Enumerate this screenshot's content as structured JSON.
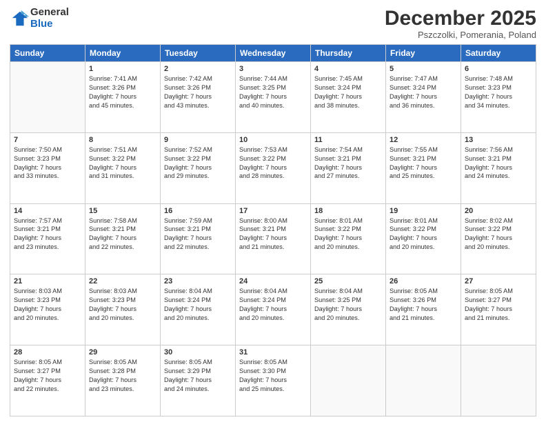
{
  "logo": {
    "general": "General",
    "blue": "Blue"
  },
  "header": {
    "month_year": "December 2025",
    "location": "Pszczolki, Pomerania, Poland"
  },
  "weekdays": [
    "Sunday",
    "Monday",
    "Tuesday",
    "Wednesday",
    "Thursday",
    "Friday",
    "Saturday"
  ],
  "weeks": [
    [
      {
        "day": "",
        "info": ""
      },
      {
        "day": "1",
        "info": "Sunrise: 7:41 AM\nSunset: 3:26 PM\nDaylight: 7 hours\nand 45 minutes."
      },
      {
        "day": "2",
        "info": "Sunrise: 7:42 AM\nSunset: 3:26 PM\nDaylight: 7 hours\nand 43 minutes."
      },
      {
        "day": "3",
        "info": "Sunrise: 7:44 AM\nSunset: 3:25 PM\nDaylight: 7 hours\nand 40 minutes."
      },
      {
        "day": "4",
        "info": "Sunrise: 7:45 AM\nSunset: 3:24 PM\nDaylight: 7 hours\nand 38 minutes."
      },
      {
        "day": "5",
        "info": "Sunrise: 7:47 AM\nSunset: 3:24 PM\nDaylight: 7 hours\nand 36 minutes."
      },
      {
        "day": "6",
        "info": "Sunrise: 7:48 AM\nSunset: 3:23 PM\nDaylight: 7 hours\nand 34 minutes."
      }
    ],
    [
      {
        "day": "7",
        "info": "Sunrise: 7:50 AM\nSunset: 3:23 PM\nDaylight: 7 hours\nand 33 minutes."
      },
      {
        "day": "8",
        "info": "Sunrise: 7:51 AM\nSunset: 3:22 PM\nDaylight: 7 hours\nand 31 minutes."
      },
      {
        "day": "9",
        "info": "Sunrise: 7:52 AM\nSunset: 3:22 PM\nDaylight: 7 hours\nand 29 minutes."
      },
      {
        "day": "10",
        "info": "Sunrise: 7:53 AM\nSunset: 3:22 PM\nDaylight: 7 hours\nand 28 minutes."
      },
      {
        "day": "11",
        "info": "Sunrise: 7:54 AM\nSunset: 3:21 PM\nDaylight: 7 hours\nand 27 minutes."
      },
      {
        "day": "12",
        "info": "Sunrise: 7:55 AM\nSunset: 3:21 PM\nDaylight: 7 hours\nand 25 minutes."
      },
      {
        "day": "13",
        "info": "Sunrise: 7:56 AM\nSunset: 3:21 PM\nDaylight: 7 hours\nand 24 minutes."
      }
    ],
    [
      {
        "day": "14",
        "info": "Sunrise: 7:57 AM\nSunset: 3:21 PM\nDaylight: 7 hours\nand 23 minutes."
      },
      {
        "day": "15",
        "info": "Sunrise: 7:58 AM\nSunset: 3:21 PM\nDaylight: 7 hours\nand 22 minutes."
      },
      {
        "day": "16",
        "info": "Sunrise: 7:59 AM\nSunset: 3:21 PM\nDaylight: 7 hours\nand 22 minutes."
      },
      {
        "day": "17",
        "info": "Sunrise: 8:00 AM\nSunset: 3:21 PM\nDaylight: 7 hours\nand 21 minutes."
      },
      {
        "day": "18",
        "info": "Sunrise: 8:01 AM\nSunset: 3:22 PM\nDaylight: 7 hours\nand 20 minutes."
      },
      {
        "day": "19",
        "info": "Sunrise: 8:01 AM\nSunset: 3:22 PM\nDaylight: 7 hours\nand 20 minutes."
      },
      {
        "day": "20",
        "info": "Sunrise: 8:02 AM\nSunset: 3:22 PM\nDaylight: 7 hours\nand 20 minutes."
      }
    ],
    [
      {
        "day": "21",
        "info": "Sunrise: 8:03 AM\nSunset: 3:23 PM\nDaylight: 7 hours\nand 20 minutes."
      },
      {
        "day": "22",
        "info": "Sunrise: 8:03 AM\nSunset: 3:23 PM\nDaylight: 7 hours\nand 20 minutes."
      },
      {
        "day": "23",
        "info": "Sunrise: 8:04 AM\nSunset: 3:24 PM\nDaylight: 7 hours\nand 20 minutes."
      },
      {
        "day": "24",
        "info": "Sunrise: 8:04 AM\nSunset: 3:24 PM\nDaylight: 7 hours\nand 20 minutes."
      },
      {
        "day": "25",
        "info": "Sunrise: 8:04 AM\nSunset: 3:25 PM\nDaylight: 7 hours\nand 20 minutes."
      },
      {
        "day": "26",
        "info": "Sunrise: 8:05 AM\nSunset: 3:26 PM\nDaylight: 7 hours\nand 21 minutes."
      },
      {
        "day": "27",
        "info": "Sunrise: 8:05 AM\nSunset: 3:27 PM\nDaylight: 7 hours\nand 21 minutes."
      }
    ],
    [
      {
        "day": "28",
        "info": "Sunrise: 8:05 AM\nSunset: 3:27 PM\nDaylight: 7 hours\nand 22 minutes."
      },
      {
        "day": "29",
        "info": "Sunrise: 8:05 AM\nSunset: 3:28 PM\nDaylight: 7 hours\nand 23 minutes."
      },
      {
        "day": "30",
        "info": "Sunrise: 8:05 AM\nSunset: 3:29 PM\nDaylight: 7 hours\nand 24 minutes."
      },
      {
        "day": "31",
        "info": "Sunrise: 8:05 AM\nSunset: 3:30 PM\nDaylight: 7 hours\nand 25 minutes."
      },
      {
        "day": "",
        "info": ""
      },
      {
        "day": "",
        "info": ""
      },
      {
        "day": "",
        "info": ""
      }
    ]
  ]
}
